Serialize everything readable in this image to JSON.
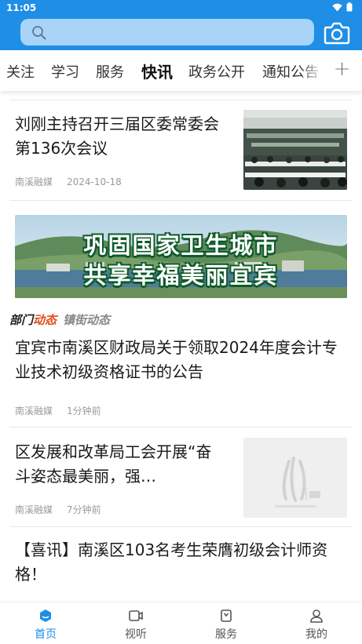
{
  "status_bar": {
    "time": "11:05"
  },
  "search": {
    "placeholder": ""
  },
  "tabs": [
    {
      "label": "关注"
    },
    {
      "label": "学习"
    },
    {
      "label": "服务"
    },
    {
      "label": "快讯",
      "active": true
    },
    {
      "label": "政务公开"
    },
    {
      "label": "通知公告"
    }
  ],
  "feed": [
    {
      "title": "刘刚主持召开三届区委常委会第136次会议",
      "source": "南溪融媒",
      "time": "2024-10-18",
      "thumb": "meeting-photo"
    },
    {
      "banner_lines": [
        "巩固国家卫生城市",
        "共享幸福美丽宜宾"
      ]
    },
    {
      "category_prefix": "部门",
      "category_highlight": "动态",
      "category_secondary": "镇街动态"
    },
    {
      "title": "宜宾市南溪区财政局关于领取2024年度会计专业技术初级资格证书的公告",
      "source": "南溪融媒",
      "time": "1分钟前"
    },
    {
      "title": "区发展和改革局工会开展“奋斗姿态最美丽，强…",
      "source": "南溪融媒",
      "time": "7分钟前",
      "thumb": "placeholder-logo"
    },
    {
      "title": "【喜讯】南溪区103名考生荣膺初级会计师资格！"
    }
  ],
  "bottom_nav": [
    {
      "label": "首页",
      "icon": "home-icon",
      "active": true
    },
    {
      "label": "视听",
      "icon": "video-icon"
    },
    {
      "label": "服务",
      "icon": "service-icon"
    },
    {
      "label": "我的",
      "icon": "profile-icon"
    }
  ],
  "colors": {
    "brand": "#1e8ee6",
    "search_bg": "#a9d4f8",
    "category_highlight": "#e24d1d"
  }
}
